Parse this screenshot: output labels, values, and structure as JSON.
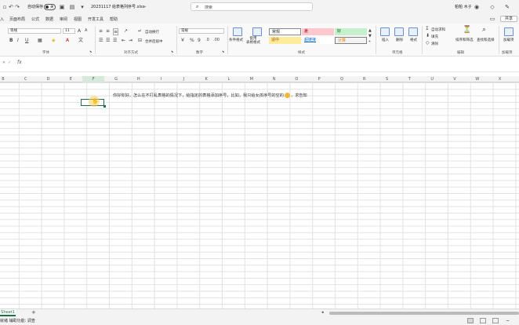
{
  "titlebar": {
    "autosave_label": "自动保存",
    "autosave_state": "关",
    "filename": "20231117 给表格列序号.xlsx",
    "search_placeholder": "搜索",
    "user_name": "帕帕 木子"
  },
  "menu": {
    "items": [
      "入",
      "页面布局",
      "公式",
      "数据",
      "审阅",
      "视图",
      "开发工具",
      "帮助"
    ],
    "share_label": "共享"
  },
  "ribbon": {
    "font_name": "等线",
    "font_size": "11",
    "bold": "B",
    "italic": "I",
    "underline": "U",
    "wrap_text": "自动换行",
    "merge_center": "合并后居中",
    "number_format": "常规",
    "cond_format": "条件格式",
    "table_format": "套用\n表格格式",
    "cell_styles": [
      "常规",
      "差",
      "好",
      "适中",
      "超链接",
      "计算"
    ],
    "insert": "插入",
    "delete": "删除",
    "format": "格式",
    "autosum": "自动求和",
    "fill": "填充",
    "clear": "清除",
    "sort_filter": "排序和筛选",
    "find_select": "查找和选择",
    "addins": "加载项",
    "groups": {
      "font": "字体",
      "alignment": "对齐方式",
      "number": "数字",
      "styles": "样式",
      "cells": "单元格",
      "editing": "编辑",
      "addins": "加载项"
    }
  },
  "formula": {
    "namebox": "",
    "fx": "fx"
  },
  "columns": [
    "B",
    "C",
    "D",
    "E",
    "F",
    "G",
    "H",
    "I",
    "J",
    "K",
    "L",
    "M",
    "N",
    "O",
    "P",
    "Q",
    "R",
    "S",
    "T",
    "U",
    "V",
    "W",
    "X"
  ],
  "active_column": "F",
  "cell": {
    "text_before_emoji": "你好你好，怎么在不打乱表格的情况下，给指定的表格添加序号，比如，我只给女孩序号的空的",
    "text_after_emoji": "，求告知"
  },
  "sheets": [
    "Sheet1"
  ],
  "status": {
    "mode_text": "就绪  辅助功能: 调查"
  },
  "colors": {
    "accent": "#1e7145",
    "style_bad_bg": "#ffc7ce",
    "style_good_bg": "#c6efce",
    "style_neutral_bg": "#ffeb9c"
  }
}
